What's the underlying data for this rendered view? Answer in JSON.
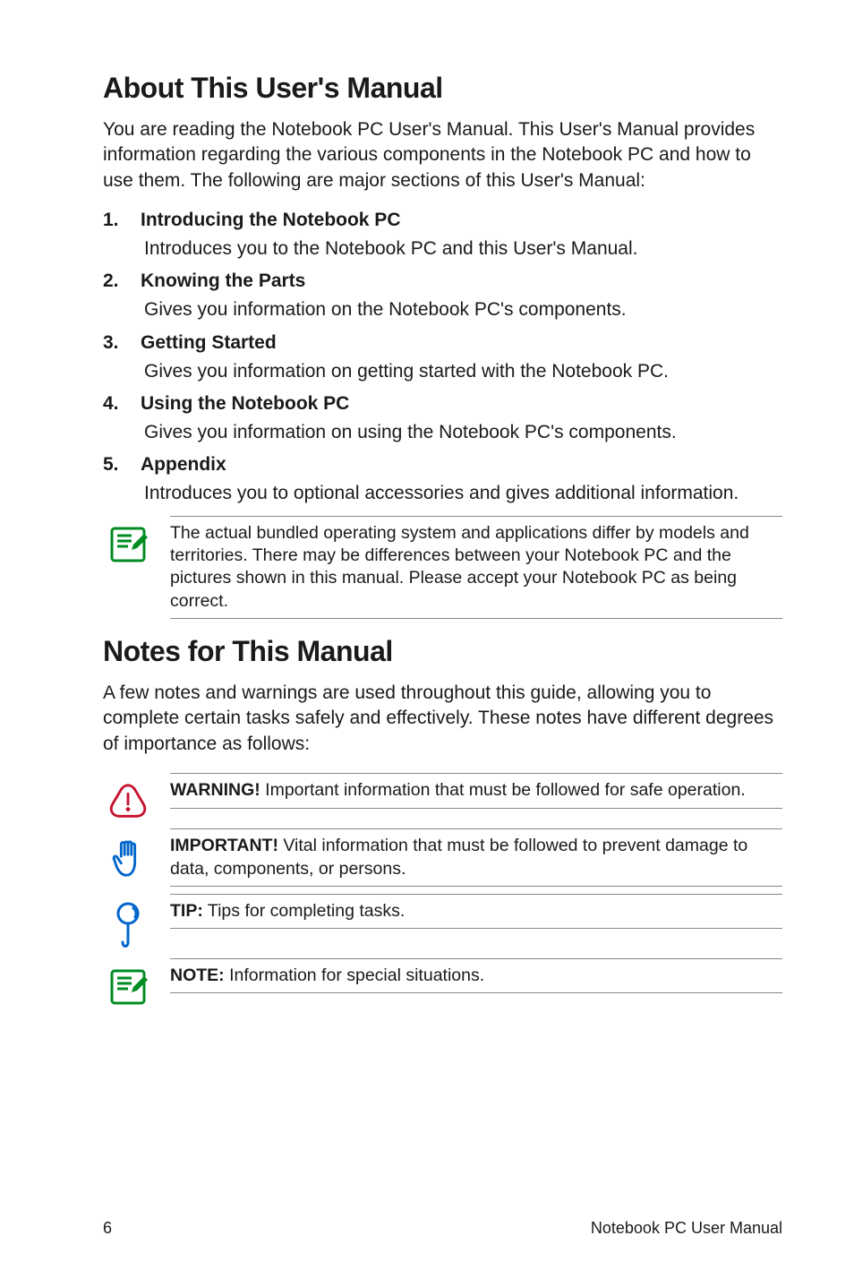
{
  "heading1": "About This User's Manual",
  "intro1": "You are reading the Notebook PC User's Manual. This User's Manual provides information regarding the various components in the Notebook PC and how to use them. The following are major sections of this User's Manual:",
  "sections": [
    {
      "num": "1.",
      "title": "Introducing the Notebook PC",
      "body": "Introduces you to the Notebook PC and this User's Manual."
    },
    {
      "num": "2.",
      "title": "Knowing the Parts",
      "body": "Gives you information on the Notebook PC's components."
    },
    {
      "num": "3.",
      "title": "Getting Started",
      "body": "Gives you information on getting started with the Notebook PC."
    },
    {
      "num": "4.",
      "title": "Using the Notebook PC",
      "body": "Gives you information on using the Notebook PC's components."
    },
    {
      "num": "5.",
      "title": "Appendix",
      "body": "Introduces you to optional accessories and gives additional information."
    }
  ],
  "note_after_sections": "The actual bundled operating system and applications differ by models and territories. There may be differences between your Notebook PC and the pictures shown in this manual. Please accept your Notebook PC as being correct.",
  "heading2": "Notes for This Manual",
  "intro2": "A few notes and warnings are used throughout this guide, allowing you to complete certain tasks safely and effectively. These notes have different degrees of importance as follows:",
  "callouts": [
    {
      "label": "WARNING!",
      "text": " Important information that must be followed for safe operation."
    },
    {
      "label": "IMPORTANT!",
      "text": " Vital information that must be followed to prevent damage to data, components, or persons."
    },
    {
      "label": "TIP:",
      "text": " Tips for completing tasks."
    },
    {
      "label": "NOTE:",
      "text": "  Information for special situations."
    }
  ],
  "footer": {
    "page": "6",
    "text": "Notebook PC User Manual"
  }
}
